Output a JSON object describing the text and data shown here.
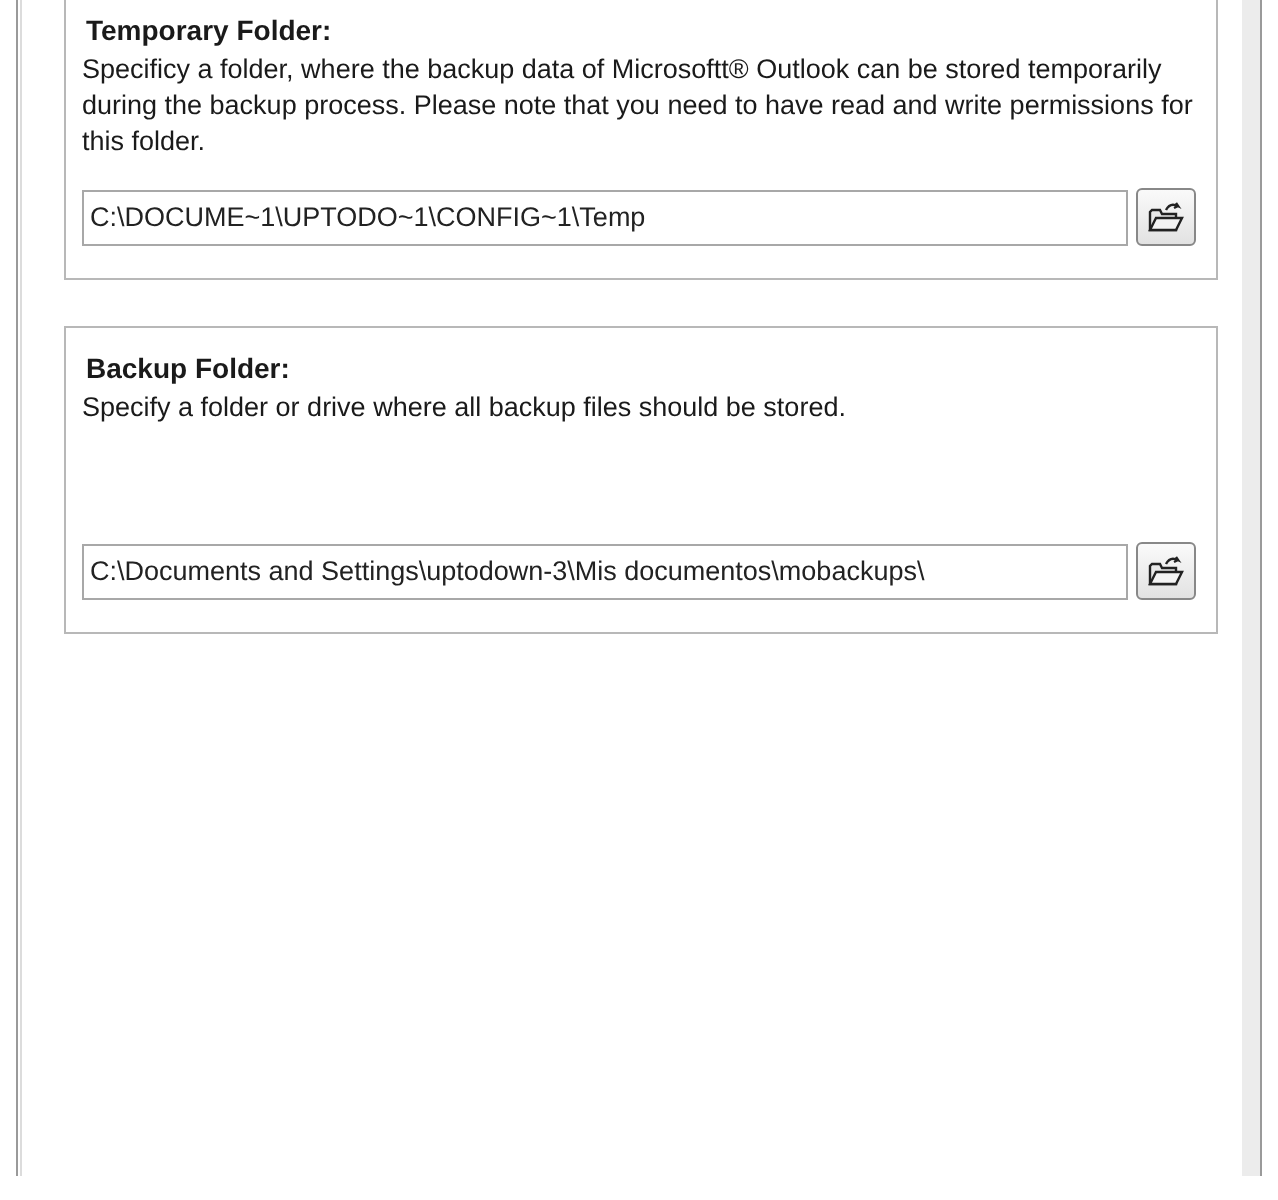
{
  "sections": [
    {
      "title": "Temporary Folder:",
      "description": "Specificy a folder, where the backup data of Microsoftt® Outlook can be stored temporarily during the backup process. Please note that you need to have read and write permissions for this folder.",
      "path": "C:\\DOCUME~1\\UPTODO~1\\CONFIG~1\\Temp"
    },
    {
      "title": "Backup Folder:",
      "description": "Specify a folder or drive where all backup files should be stored.",
      "path": "C:\\Documents and Settings\\uptodown-3\\Mis documentos\\mobackups\\"
    }
  ]
}
